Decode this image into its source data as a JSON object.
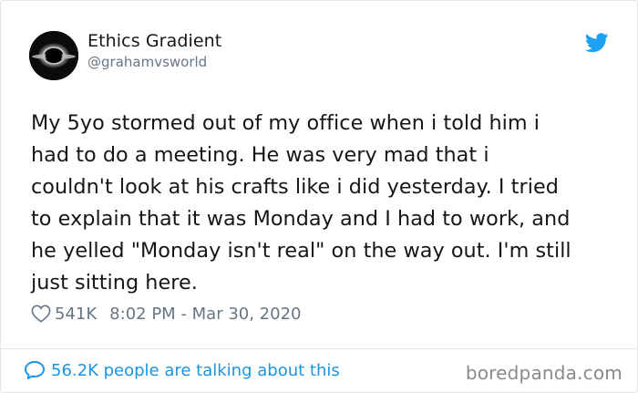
{
  "author": {
    "display_name": "Ethics Gradient",
    "handle": "@grahamvsworld"
  },
  "tweet": {
    "text": "My 5yo stormed out of my office when i told him i\nhad to do a meeting. He was very mad that i\ncouldn't look at his crafts like i did yesterday. I tried\nto explain that it was Monday and I had to work, and\nhe yelled \"Monday isn't real\" on the way out. I'm still\njust sitting here.",
    "likes": "541K",
    "timestamp": "8:02 PM - Mar 30, 2020"
  },
  "footer": {
    "conversation_text": "56.2K people are talking about this",
    "watermark": "boredpanda.com"
  },
  "icons": {
    "brand": "twitter-bird-icon",
    "like": "heart-icon",
    "conversation": "speech-bubble-icon"
  },
  "colors": {
    "twitter_blue": "#1b95e0",
    "secondary_text": "#657786",
    "primary_text": "#14171a"
  }
}
